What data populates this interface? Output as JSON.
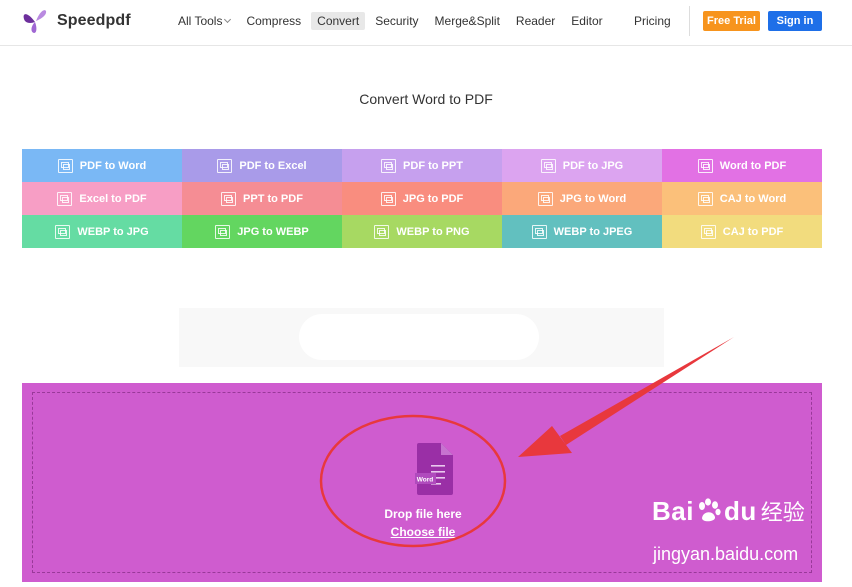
{
  "brand": {
    "name": "Speedpdf"
  },
  "nav": {
    "items": [
      {
        "label": "All Tools",
        "has_dropdown": true,
        "active": false
      },
      {
        "label": "Compress",
        "active": false
      },
      {
        "label": "Convert",
        "active": true
      },
      {
        "label": "Security",
        "active": false
      },
      {
        "label": "Merge&Split",
        "active": false
      },
      {
        "label": "Reader",
        "active": false
      },
      {
        "label": "Editor",
        "active": false
      }
    ],
    "pricing": "Pricing",
    "free_trial": "Free Trial",
    "sign_in": "Sign in"
  },
  "page": {
    "title": "Convert Word to PDF"
  },
  "tools": [
    {
      "label": "PDF to Word",
      "color": "#7ab8f5"
    },
    {
      "label": "PDF to Excel",
      "color": "#a99be9"
    },
    {
      "label": "PDF to PPT",
      "color": "#c6a0ee"
    },
    {
      "label": "PDF to JPG",
      "color": "#dca4f0"
    },
    {
      "label": "Word to PDF",
      "color": "#e271e4"
    },
    {
      "label": "Excel to PDF",
      "color": "#f79ec5"
    },
    {
      "label": "PPT to PDF",
      "color": "#f58d94"
    },
    {
      "label": "JPG to PDF",
      "color": "#f98d7f"
    },
    {
      "label": "JPG to Word",
      "color": "#fba87a"
    },
    {
      "label": "CAJ to Word",
      "color": "#fbc07a"
    },
    {
      "label": "WEBP to JPG",
      "color": "#65dca3"
    },
    {
      "label": "JPG to WEBP",
      "color": "#63d660"
    },
    {
      "label": "WEBP to PNG",
      "color": "#a7d962"
    },
    {
      "label": "WEBP to JPEG",
      "color": "#62c0bf"
    },
    {
      "label": "CAJ to PDF",
      "color": "#f2dc7e"
    }
  ],
  "dropzone": {
    "color": "#cf5ccf",
    "file_badge": "Word",
    "drop_text": "Drop file here",
    "choose_text": "Choose file"
  },
  "annotation": {
    "color": "#e8383d"
  },
  "watermark": {
    "logo_bai": "Bai",
    "logo_du": "du",
    "logo_cn": "经验",
    "url": "jingyan.baidu.com"
  }
}
